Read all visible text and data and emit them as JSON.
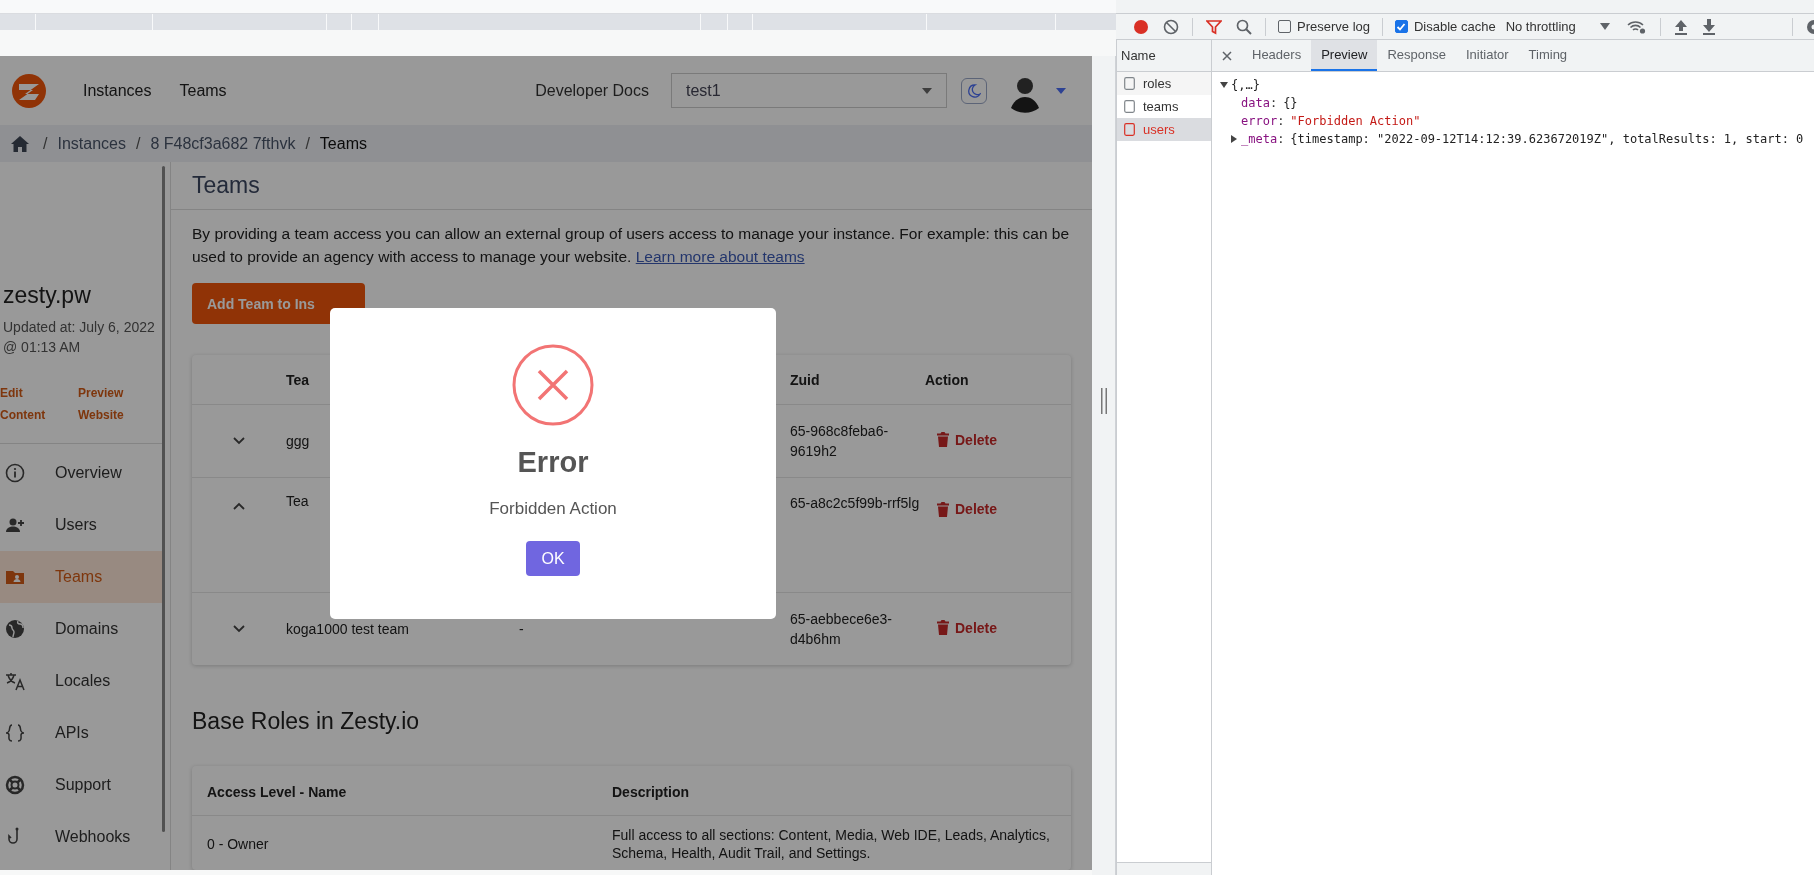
{
  "app": {
    "nav": [
      {
        "label": "Instances"
      },
      {
        "label": "Teams"
      }
    ],
    "developer_docs": "Developer Docs",
    "instance_select": {
      "value": "test1"
    },
    "breadcrumb": [
      {
        "separator": "/",
        "label": "Instances",
        "current": false
      },
      {
        "separator": "/",
        "label": "8 F48cf3a682 7fthvk",
        "current": false
      },
      {
        "separator": "/",
        "label": "Teams",
        "current": true
      }
    ],
    "sidebar": {
      "title": "zesty.pw",
      "updated": "Updated at: July 6, 2022 @ 01:13 AM",
      "links": [
        "Edit Content",
        "Preview Website"
      ],
      "items": [
        {
          "label": "Overview",
          "selected": false
        },
        {
          "label": "Users",
          "selected": false
        },
        {
          "label": "Teams",
          "selected": true
        },
        {
          "label": "Domains",
          "selected": false
        },
        {
          "label": "Locales",
          "selected": false
        },
        {
          "label": "APIs",
          "selected": false
        },
        {
          "label": "Support",
          "selected": false
        },
        {
          "label": "Webhooks",
          "selected": false
        }
      ]
    },
    "teams": {
      "title": "Teams",
      "description": "By providing a team access you can allow an external group of users access to manage your instance. For example: this can be used to provide an agency with access to manage your website.",
      "learn_more": "Learn more about teams",
      "add_button": "Add Team to Ins",
      "columns": [
        "Tea",
        "Zuid",
        "Action"
      ],
      "rows": [
        {
          "name": "ggg",
          "column_3": "",
          "zuid": "65-968c8feba6-9619h2",
          "action": "Delete",
          "expanded": false
        },
        {
          "name": "Tea",
          "column_3": "",
          "zuid": "65-a8c2c5f99b-rrf5lg",
          "action": "Delete",
          "expanded": true
        },
        {
          "name": "koga1000 test team",
          "column_3": "-",
          "zuid": "65-aebbece6e3-d4b6hm",
          "action": "Delete",
          "expanded": false
        }
      ]
    },
    "base_roles": {
      "title": "Base Roles in Zesty.io",
      "columns": [
        "Access Level - Name",
        "Description"
      ],
      "rows": [
        {
          "name": "0 - Owner",
          "description": "Full access to all sections: Content, Media, Web IDE, Leads, Analytics, Schema, Health, Audit Trail, and Settings."
        }
      ]
    },
    "modal": {
      "title": "Error",
      "message": "Forbidden Action",
      "button": "OK"
    }
  },
  "devtools": {
    "toolbar": {
      "recording": true,
      "filter_active": true,
      "preserve_log": {
        "label": "Preserve log",
        "checked": false
      },
      "disable_cache": {
        "label": "Disable cache",
        "checked": true
      },
      "throttling": "No throttling"
    },
    "name_header": "Name",
    "requests": [
      {
        "name": "roles",
        "selected": false,
        "failed": false
      },
      {
        "name": "teams",
        "selected": false,
        "failed": false
      },
      {
        "name": "users",
        "selected": true,
        "failed": true
      }
    ],
    "tabs": [
      {
        "label": "Headers",
        "selected": false
      },
      {
        "label": "Preview",
        "selected": true
      },
      {
        "label": "Response",
        "selected": false
      },
      {
        "label": "Initiator",
        "selected": false
      },
      {
        "label": "Timing",
        "selected": false
      }
    ],
    "preview": {
      "root": "{,…}",
      "expanded": true,
      "fields": [
        {
          "key": "data",
          "separator": ":",
          "value": "{}",
          "kind": "object"
        },
        {
          "key": "error",
          "separator": ":",
          "value": "\"Forbidden Action\"",
          "kind": "string"
        },
        {
          "key": "_meta",
          "separator": ":",
          "value": "{timestamp: \"2022-09-12T14:12:39.623672019Z\", totalResults: 1, start: 0",
          "kind": "object",
          "expanded": false
        }
      ]
    }
  }
}
